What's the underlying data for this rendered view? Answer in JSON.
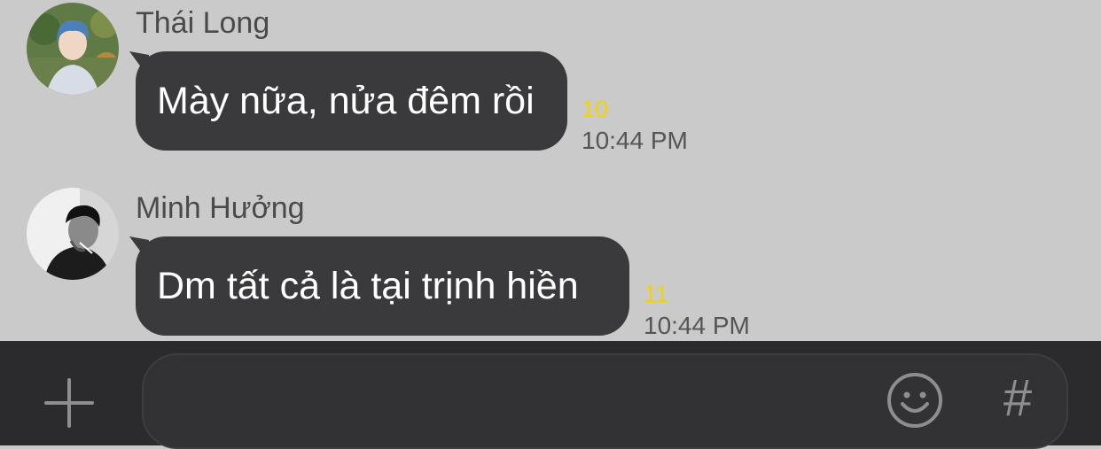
{
  "messages": [
    {
      "sender": "Thái Long",
      "text": "Mày nữa, nửa đêm rồi",
      "unread": "10",
      "time": "10:44 PM"
    },
    {
      "sender": "Minh Hưởng",
      "text": "Dm tất cả là tại trịnh hiền",
      "unread": "11",
      "time": "10:44 PM"
    }
  ],
  "composer": {
    "value": "",
    "hash_symbol": "#"
  },
  "icons": [
    "plus-icon",
    "emoji-icon",
    "hashtag-icon"
  ],
  "colors": {
    "chat_background": "#cacaca",
    "bubble": "#3a3a3c",
    "unread_count": "#f2d400",
    "input_bar": "#2b2b2d"
  }
}
